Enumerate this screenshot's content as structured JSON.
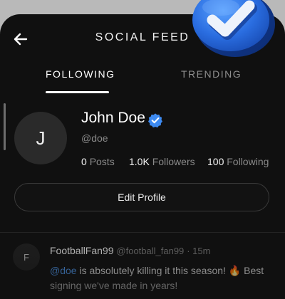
{
  "header": {
    "title": "SOCIAL FEED"
  },
  "tabs": [
    {
      "label": "FOLLOWING"
    },
    {
      "label": "TRENDING"
    }
  ],
  "profile": {
    "avatar_letter": "J",
    "name": "John Doe",
    "handle": "@doe",
    "stats": {
      "posts_value": "0",
      "posts_label": "Posts",
      "followers_value": "1.0K",
      "followers_label": "Followers",
      "following_value": "100",
      "following_label": "Following"
    },
    "edit_label": "Edit Profile"
  },
  "post": {
    "avatar_letter": "F",
    "author": "FootballFan99",
    "handle": "@football_fan99",
    "time": "· 15m",
    "mention": "@doe",
    "text": " is absolutely killing it this season! 🔥 Best signing we've made in years!"
  },
  "colors": {
    "accent": "#4a8fe0",
    "background": "#101010",
    "badge": "#3d8af0"
  },
  "icons": {
    "back": "arrow-left-icon",
    "verified": "verified-badge-icon",
    "decoration": "check-3d-icon"
  }
}
